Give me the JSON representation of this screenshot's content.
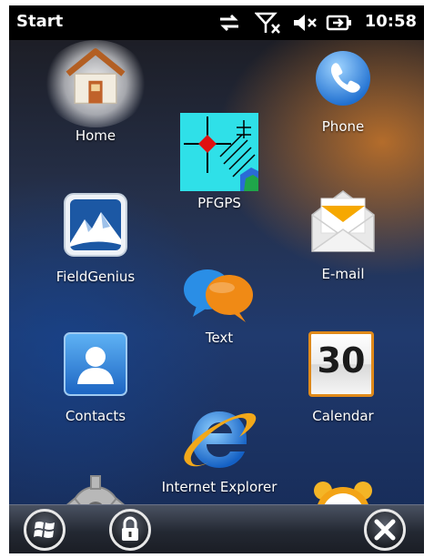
{
  "status": {
    "title": "Start",
    "time": "10:58",
    "icons": [
      "connectivity-icon",
      "signal-off-icon",
      "volume-mute-icon",
      "battery-charging-icon"
    ]
  },
  "apps": [
    {
      "label": "Home",
      "icon": "home-icon"
    },
    {
      "label": "Phone",
      "icon": "phone-icon"
    },
    {
      "label": "PFGPS",
      "icon": "pfgps-icon"
    },
    {
      "label": "FieldGenius",
      "icon": "fieldgenius-icon"
    },
    {
      "label": "E-mail",
      "icon": "email-icon"
    },
    {
      "label": "Text",
      "icon": "text-icon"
    },
    {
      "label": "Contacts",
      "icon": "contacts-icon"
    },
    {
      "label": "Calendar",
      "icon": "calendar-icon",
      "day": "30"
    },
    {
      "label": "Internet Explorer",
      "icon": "internet-explorer-icon"
    },
    {
      "label": "",
      "icon": "settings-icon"
    },
    {
      "label": "",
      "icon": "alarm-clock-icon"
    }
  ],
  "taskbar": [
    "windows-start-icon",
    "lock-icon",
    "close-icon"
  ],
  "colors": {
    "highlight": "#ffffff",
    "email_accent": "#f6a800",
    "chat_blue": "#2a8ee6",
    "chat_orange": "#f08a15",
    "contacts_blue": "#2c7cd1"
  }
}
